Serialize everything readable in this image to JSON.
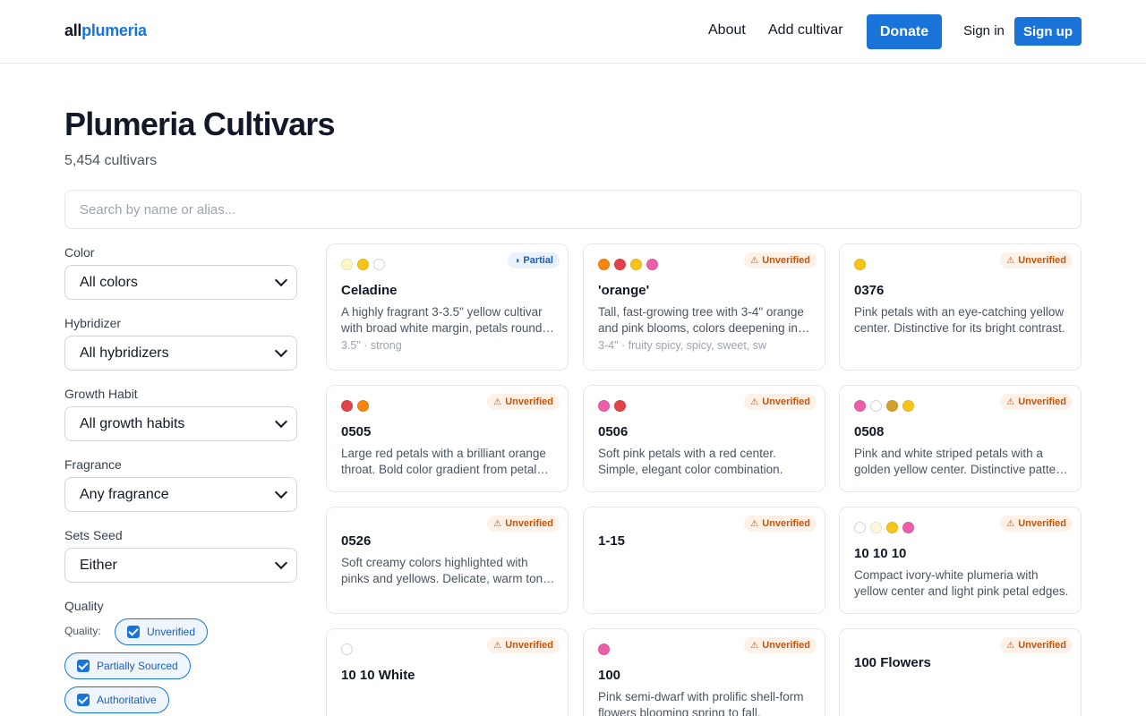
{
  "header": {
    "logo_part1": "all",
    "logo_part2": "plumeria",
    "nav_about": "About",
    "nav_add": "Add cultivar",
    "donate": "Donate",
    "sign_in": "Sign in",
    "sign_up": "Sign up"
  },
  "page": {
    "title": "Plumeria Cultivars",
    "count": "5,454 cultivars"
  },
  "search": {
    "placeholder": "Search by name or alias...",
    "value": ""
  },
  "filters": {
    "color_label": "Color",
    "color_value": "All colors",
    "hybridizer_label": "Hybridizer",
    "hybridizer_value": "All hybridizers",
    "growth_label": "Growth Habit",
    "growth_value": "All growth habits",
    "fragrance_label": "Fragrance",
    "fragrance_value": "Any fragrance",
    "seed_label": "Sets Seed",
    "seed_value": "Either",
    "quality_label": "Quality",
    "quality_inline": "Quality:",
    "quality_options": [
      "Unverified",
      "Partially Sourced",
      "Authoritative"
    ]
  },
  "colors": {
    "accent": "#1a73d9",
    "unverified": "#c2560c"
  },
  "cards": [
    {
      "name": "Celadine",
      "badge": "Partial",
      "badge_icon": "half-circle-icon",
      "dots": [
        "#fdf7c3",
        "#f5c518",
        "#ffffff"
      ],
      "desc": "A highly fragrant 3-3.5\" yellow cultivar with broad white margin, petals rounded with a soft overlap.",
      "meta": "3.5\" · strong"
    },
    {
      "name": "'orange'",
      "badge": "Unverified",
      "badge_icon": "warning-icon",
      "dots": [
        "#f5870f",
        "#e2424a",
        "#f5c518",
        "#ec5fa8"
      ],
      "desc": "Tall, fast-growing tree with 3-4\" orange and pink blooms, colors deepening in full sun.",
      "meta": "3-4\" · fruity spicy, spicy, sweet, sw"
    },
    {
      "name": "0376",
      "badge": "Unverified",
      "badge_icon": "warning-icon",
      "dots": [
        "#f5c518"
      ],
      "desc": "Pink petals with an eye-catching yellow center. Distinctive for its bright contrast.",
      "meta": ""
    },
    {
      "name": "0505",
      "badge": "Unverified",
      "badge_icon": "warning-icon",
      "dots": [
        "#e2424a",
        "#f5870f"
      ],
      "desc": "Large red petals with a brilliant orange throat. Bold color gradient from petal edge to center.",
      "meta": ""
    },
    {
      "name": "0506",
      "badge": "Unverified",
      "badge_icon": "warning-icon",
      "dots": [
        "#ec5fa8",
        "#e2424a"
      ],
      "desc": "Soft pink petals with a red center. Simple, elegant color combination.",
      "meta": ""
    },
    {
      "name": "0508",
      "badge": "Unverified",
      "badge_icon": "warning-icon",
      "dots": [
        "#ec5fa8",
        "#ffffff",
        "#d4a22c",
        "#f5c518"
      ],
      "desc": "Pink and white striped petals with a golden yellow center. Distinctive pattern throughout.",
      "meta": ""
    },
    {
      "name": "0526",
      "badge": "Unverified",
      "badge_icon": "warning-icon",
      "dots": [],
      "desc": "Soft creamy colors highlighted with pinks and yellows. Delicate, warm tones blend together.",
      "meta": ""
    },
    {
      "name": "1-15",
      "badge": "Unverified",
      "badge_icon": "warning-icon",
      "dots": [],
      "desc": "",
      "meta": ""
    },
    {
      "name": "10 10 10",
      "badge": "Unverified",
      "badge_icon": "warning-icon",
      "dots": [
        "#ffffff",
        "#fdf7e0",
        "#f5c518",
        "#ec5fa8"
      ],
      "desc": "Compact ivory-white plumeria with yellow center and light pink petal edges.",
      "meta": ""
    },
    {
      "name": "10 10 White",
      "badge": "Unverified",
      "badge_icon": "warning-icon",
      "dots": [
        "#ffffff"
      ],
      "desc": "",
      "meta": ""
    },
    {
      "name": "100",
      "badge": "Unverified",
      "badge_icon": "warning-icon",
      "dots": [
        "#ec5fa8"
      ],
      "desc": "Pink semi-dwarf with prolific shell-form flowers blooming spring to fall.",
      "meta": ""
    },
    {
      "name": "100 Flowers",
      "badge": "Unverified",
      "badge_icon": "warning-icon",
      "dots": [],
      "desc": "",
      "meta": ""
    }
  ]
}
